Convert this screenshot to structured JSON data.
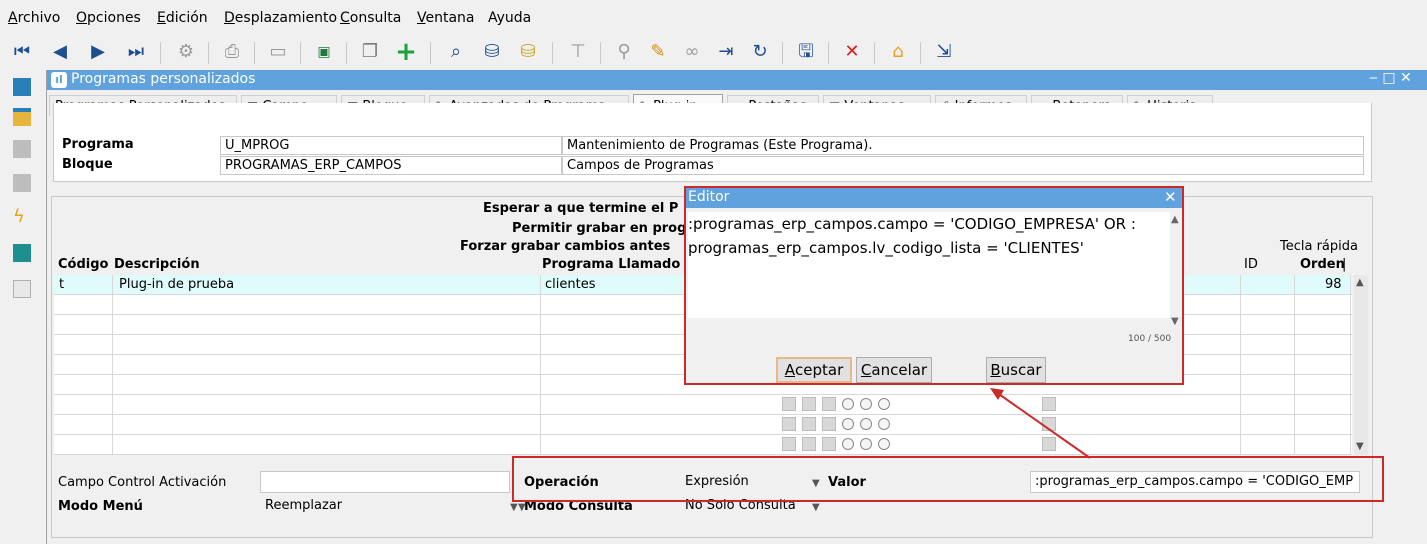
{
  "menu": [
    {
      "label": "Archivo",
      "u": "A",
      "rest": "rchivo"
    },
    {
      "label": "Opciones",
      "u": "O",
      "rest": "pciones"
    },
    {
      "label": "Edición",
      "u": "E",
      "rest": "dición"
    },
    {
      "label": "Desplazamiento",
      "u": "D",
      "rest": "esplazamiento"
    },
    {
      "label": "Consulta",
      "u": "C",
      "rest": "onsulta"
    },
    {
      "label": "Ventana",
      "u": "V",
      "rest": "entana"
    },
    {
      "label": "Ayuda",
      "u": "",
      "rest": "Ayuda"
    }
  ],
  "window": {
    "title": "Programas personalizados",
    "controls": "‒ □ ✕"
  },
  "tabs": [
    {
      "label": "Programas Personalizados",
      "icon": ""
    },
    {
      "label": "Campo",
      "icon": "▦"
    },
    {
      "label": "Bloque",
      "icon": "▦"
    },
    {
      "label": "Avanzadas de Programa",
      "icon": "✎"
    },
    {
      "label": "Plug-in",
      "icon": "✎"
    },
    {
      "label": "Pestañas",
      "icon": "▭"
    },
    {
      "label": "Ventanas",
      "icon": "▤"
    },
    {
      "label": "Informes",
      "icon": "⎙"
    },
    {
      "label": "Botonera",
      "icon": "▭"
    },
    {
      "label": "Historia",
      "icon": "✎"
    }
  ],
  "info": {
    "programa_label": "Programa",
    "programa_code": "U_MPROG",
    "programa_desc": "Mantenimiento de Programas (Este Programa).",
    "bloque_label": "Bloque",
    "bloque_code": "PROGRAMAS_ERP_CAMPOS",
    "bloque_desc": "Campos de Programas"
  },
  "grid": {
    "header_esperar": "Esperar a que termine el P",
    "header_permitir": "Permitir grabar en prog",
    "header_forzar": "Forzar grabar cambios antes",
    "col_codigo": "Código",
    "col_descripcion": "Descripción",
    "col_programa": "Programa Llamado",
    "col_tecla": "Tecla rápida",
    "col_id": "ID",
    "col_orden": "Orden",
    "rows": [
      {
        "codigo": "t",
        "descripcion": "Plug-in de prueba",
        "programa": "clientes",
        "orden": "98"
      }
    ]
  },
  "form": {
    "campo_control_label": "Campo Control Activación",
    "campo_control_value": "",
    "operacion_label": "Operación",
    "operacion_value": "Expresión",
    "valor_label": "Valor",
    "valor_value": ":programas_erp_campos.campo = 'CODIGO_EMP",
    "modo_menu_label": "Modo Menú",
    "modo_menu_value": "Reemplazar",
    "modo_consulta_label": "Modo Consulta",
    "modo_consulta_value": "No Solo Consulta"
  },
  "editor": {
    "title": "Editor",
    "line1": ":programas_erp_campos.campo = 'CODIGO_EMPRESA' OR :",
    "line2": "programas_erp_campos.lv_codigo_lista = 'CLIENTES'",
    "counter": "100 / 500",
    "accept_label": "Aceptar",
    "accept_u": "A",
    "cancel_label": "Cancelar",
    "cancel_u": "C",
    "search_label": "Buscar",
    "search_u": "B"
  },
  "colors": {
    "accent": "#5fa2dd",
    "highlight": "#cc2a2a",
    "selected_row": "#e0fbfb"
  }
}
